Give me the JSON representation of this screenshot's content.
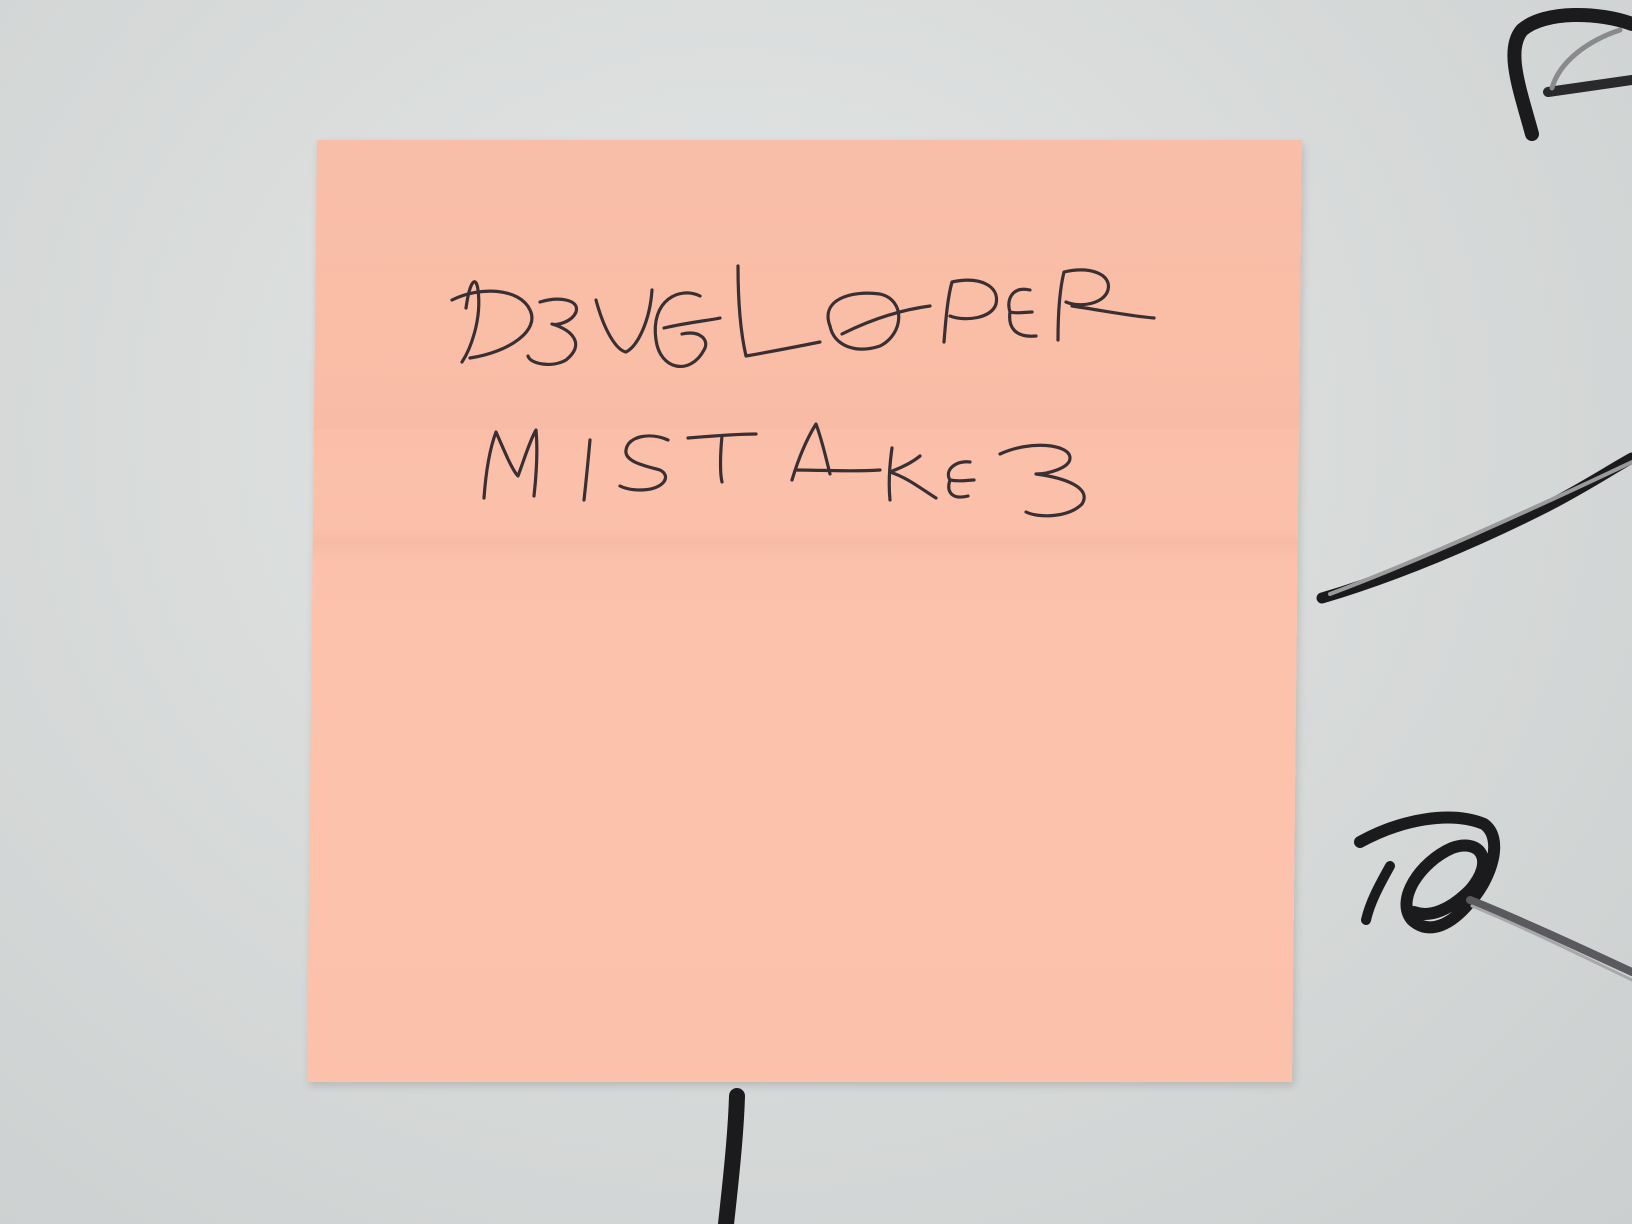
{
  "note": {
    "line1": "DEVELOPER",
    "line2": "MISTAKES",
    "paper_color": "#fbc0aa",
    "ink_color": "#3a2f32"
  },
  "background": {
    "wall_color": "#dcdfde",
    "marker_color": "#1b1b1d"
  }
}
